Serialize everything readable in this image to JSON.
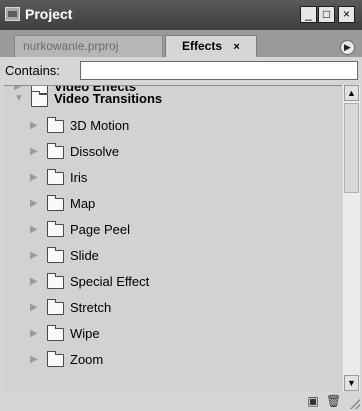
{
  "window": {
    "title": "Project",
    "controls": {
      "minimize": "_",
      "maximize": "□",
      "close": "×"
    }
  },
  "tabs": [
    {
      "label": "nurkowanie.prproj",
      "active": false
    },
    {
      "label": "Effects",
      "active": true,
      "close": "×"
    }
  ],
  "panel_menu_icon": "▶",
  "search": {
    "label": "Contains:",
    "value": ""
  },
  "tree": {
    "partial": {
      "label": "Video Effects",
      "twisty": "▶"
    },
    "group": {
      "label": "Video Transitions",
      "twisty": "▼"
    },
    "items": [
      {
        "label": "3D Motion",
        "twisty": "▶"
      },
      {
        "label": "Dissolve",
        "twisty": "▶"
      },
      {
        "label": "Iris",
        "twisty": "▶"
      },
      {
        "label": "Map",
        "twisty": "▶"
      },
      {
        "label": "Page Peel",
        "twisty": "▶"
      },
      {
        "label": "Slide",
        "twisty": "▶"
      },
      {
        "label": "Special Effect",
        "twisty": "▶"
      },
      {
        "label": "Stretch",
        "twisty": "▶"
      },
      {
        "label": "Wipe",
        "twisty": "▶"
      },
      {
        "label": "Zoom",
        "twisty": "▶"
      }
    ]
  },
  "scrollbar": {
    "up": "▲",
    "down": "▼"
  },
  "toolbar": {
    "new_bin_icon": "▣",
    "delete_icon": "🗑"
  }
}
